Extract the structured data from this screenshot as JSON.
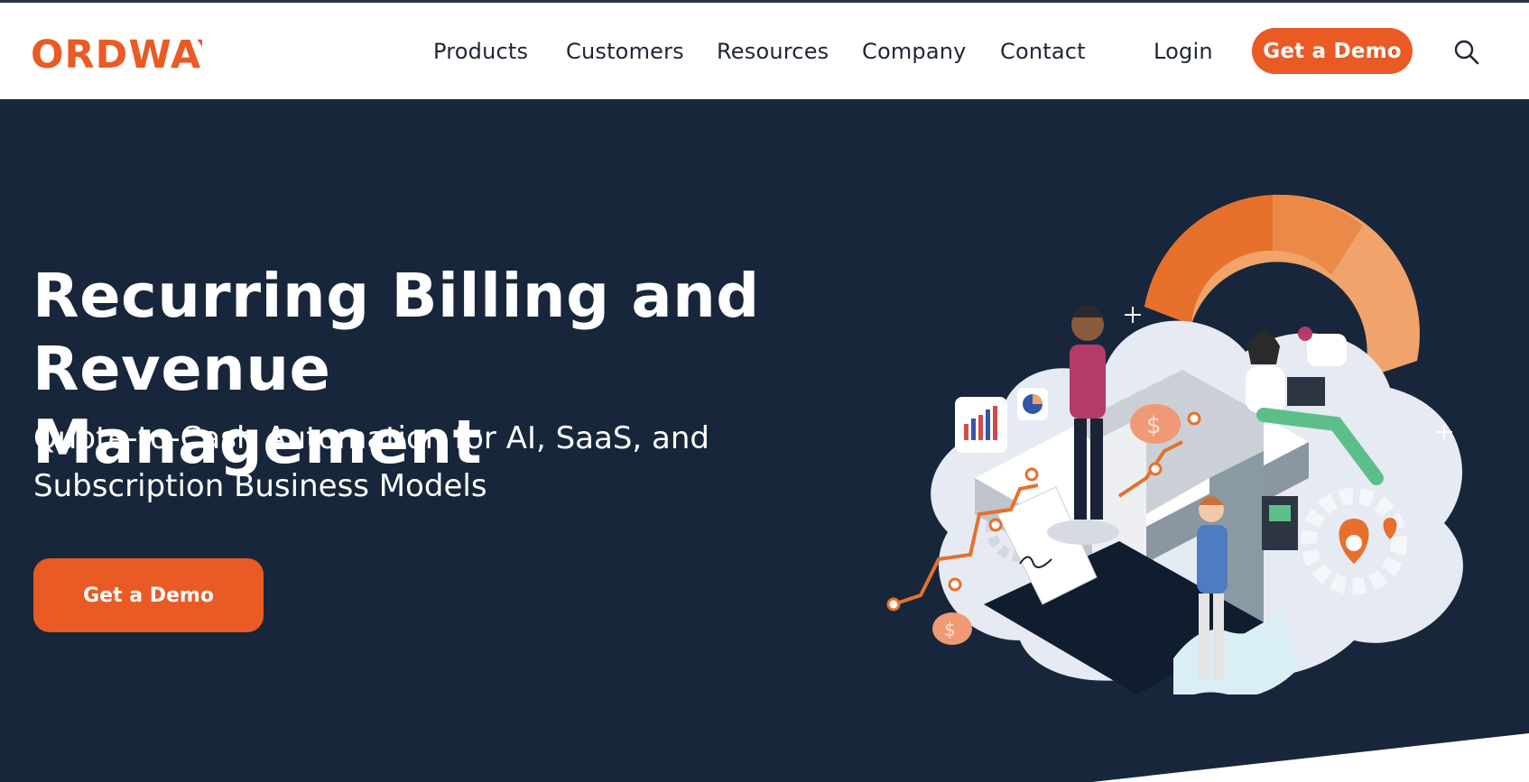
{
  "brand": {
    "name": "ORDWAY",
    "color": "#ea5a24"
  },
  "nav": {
    "items": [
      {
        "label": "Products"
      },
      {
        "label": "Customers"
      },
      {
        "label": "Resources"
      },
      {
        "label": "Company"
      },
      {
        "label": "Contact"
      }
    ],
    "login_label": "Login",
    "demo_label": "Get a Demo",
    "search_icon": "search-icon"
  },
  "hero": {
    "title_line1": "Recurring Billing and",
    "title_line2": "Revenue Management",
    "subtitle_line1": "Quote-to-Cash Automation for AI, SaaS, and",
    "subtitle_line2": "Subscription Business Models",
    "cta_label": "Get a Demo",
    "background_color": "#17263a",
    "cta_color": "#ea5a24"
  },
  "illustration": {
    "icon": "billing-automation-illustration"
  }
}
